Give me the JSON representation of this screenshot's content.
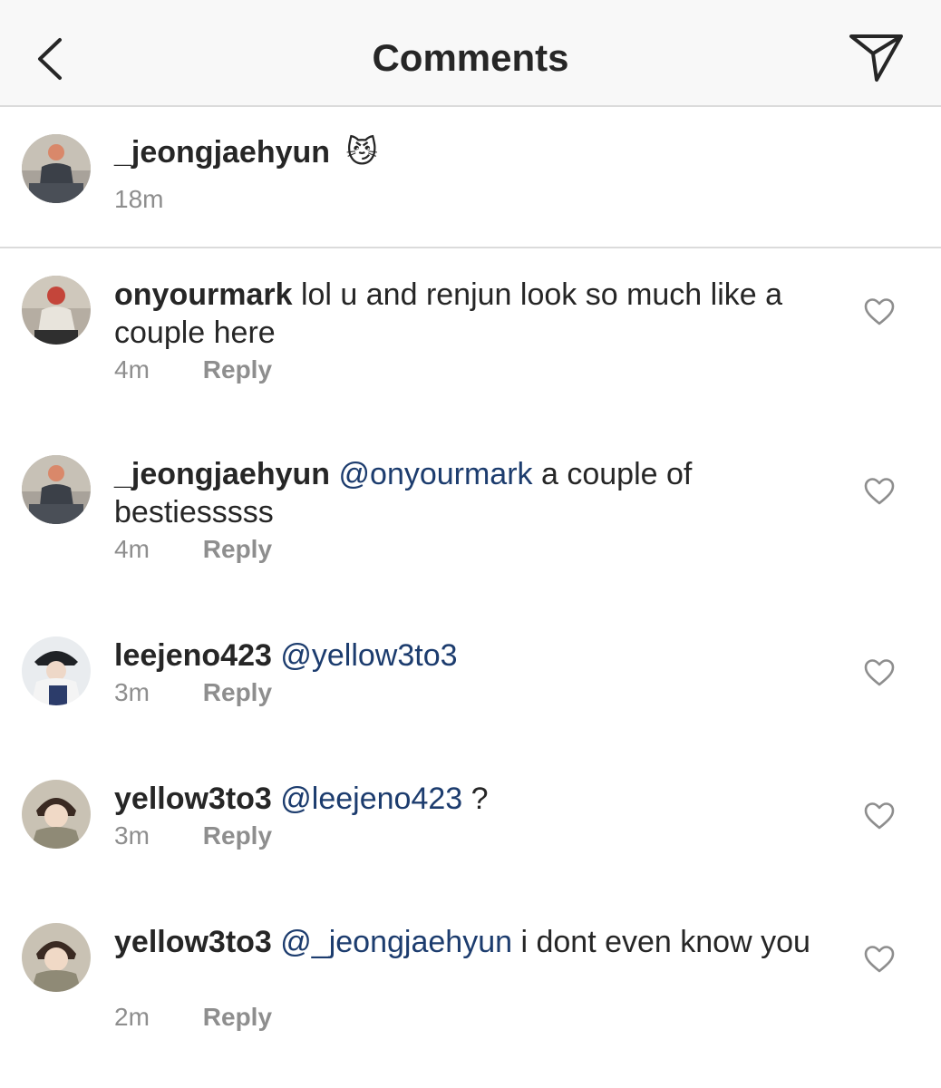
{
  "header": {
    "title": "Comments",
    "back_icon": "chevron-left-icon",
    "send_icon": "paper-plane-icon"
  },
  "caption": {
    "username": "_jeongjaehyun",
    "emoji": "😼",
    "time": "18m"
  },
  "comments": [
    {
      "username": "onyourmark",
      "mention": "",
      "text": "lol u and renjun look so much like a couple here",
      "time": "4m",
      "reply": "Reply"
    },
    {
      "username": "_jeongjaehyun",
      "mention": "@onyourmark",
      "text": "a couple of bestiesssss",
      "time": "4m",
      "reply": "Reply"
    },
    {
      "username": "leejeno423",
      "mention": "@yellow3to3",
      "text": "",
      "time": "3m",
      "reply": "Reply"
    },
    {
      "username": "yellow3to3",
      "mention": "@leejeno423",
      "text": "?",
      "time": "3m",
      "reply": "Reply"
    },
    {
      "username": "yellow3to3",
      "mention": "@_jeongjaehyun",
      "text": "i dont even know you",
      "time": "2m",
      "reply": "Reply"
    }
  ],
  "colors": {
    "mention": "#1c3c6e",
    "meta": "#8e8e8e",
    "header_bg": "#f8f8f8",
    "divider": "#dbdbdb"
  }
}
